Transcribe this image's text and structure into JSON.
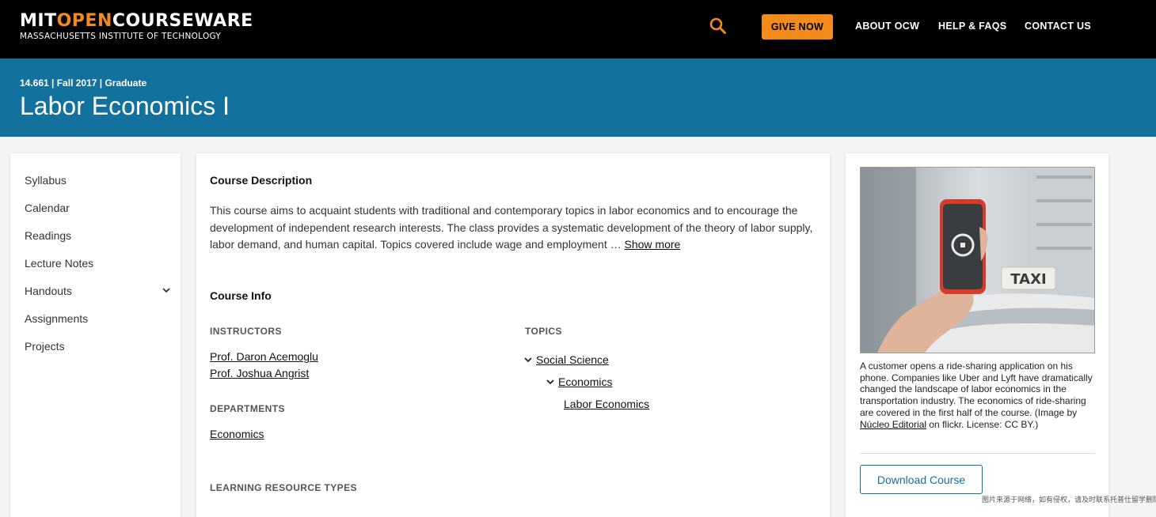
{
  "header": {
    "logo": {
      "mit": "MIT",
      "open": "OPEN",
      "courseware": "COURSEWARE",
      "subtitle": "MASSACHUSETTS INSTITUTE OF TECHNOLOGY"
    },
    "give_now": "GIVE NOW",
    "nav": [
      "ABOUT OCW",
      "HELP & FAQS",
      "CONTACT US"
    ],
    "accent_color": "#f28b1c"
  },
  "banner": {
    "meta": "14.661 | Fall 2017 | Graduate",
    "title": "Labor Economics I",
    "color": "#13729d"
  },
  "sidebar": {
    "items": [
      {
        "label": "Syllabus"
      },
      {
        "label": "Calendar"
      },
      {
        "label": "Readings"
      },
      {
        "label": "Lecture Notes"
      },
      {
        "label": "Handouts",
        "icon": "chevron-down-icon"
      },
      {
        "label": "Assignments"
      },
      {
        "label": "Projects"
      }
    ]
  },
  "main": {
    "course_description_heading": "Course Description",
    "description": "This course aims to acquaint students with traditional and contemporary topics in labor economics and to encourage the development of independent research interests. The class provides a systematic development of the theory of labor supply, labor demand, and human capital. Topics covered include wage and employment …",
    "show_more": "Show more",
    "course_info_heading": "Course Info",
    "instructors_label": "INSTRUCTORS",
    "instructors": [
      "Prof. Daron Acemoglu",
      "Prof. Joshua Angrist"
    ],
    "departments_label": "DEPARTMENTS",
    "departments": [
      "Economics"
    ],
    "topics_label": "TOPICS",
    "topics": [
      "Social Science",
      "Economics",
      "Labor Economics"
    ],
    "learning_resource_types_label": "LEARNING RESOURCE TYPES"
  },
  "aside": {
    "photo_icon": "phone-photo",
    "taxi_sign": "TAXI",
    "caption_text": "A customer opens a ride-sharing application on his phone. Companies like Uber and Lyft have dramatically changed the landscape of labor economics in the transportation industry. The economics of ride-sharing are covered in the first half of the course. (Image by ",
    "caption_link": "Núcleo Editorial",
    "caption_tail": " on flickr. License: CC BY.)",
    "download_label": "Download Course"
  },
  "watermark": "图片来源于网络，如有侵权，请及时联系托普仕留学删除"
}
